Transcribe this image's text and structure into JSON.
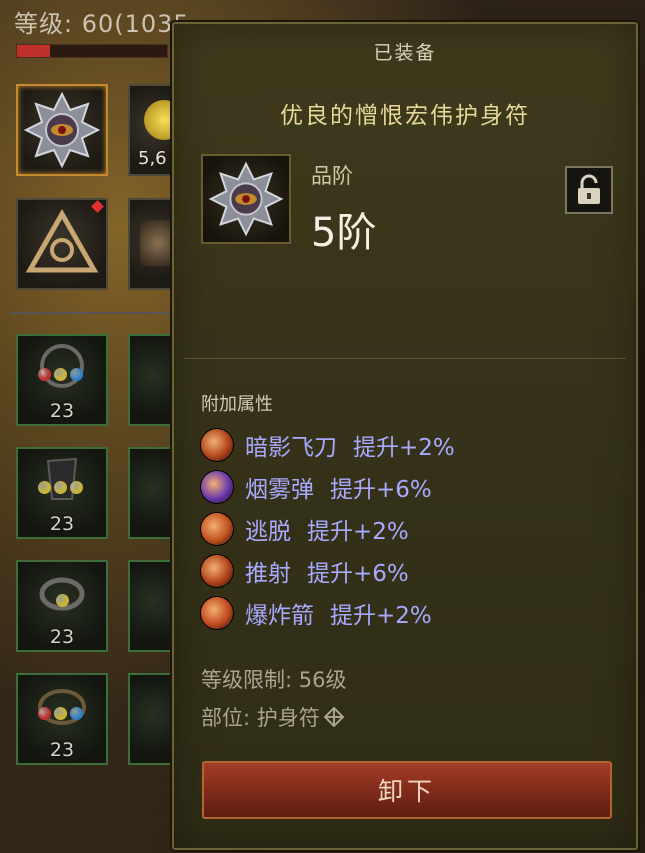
{
  "header": {
    "level_text": "等级: 60(1035"
  },
  "xp": {
    "progress": 0.22
  },
  "inventory": {
    "top_slot_partial_text": "5,6",
    "rows": [
      {
        "count": "23",
        "gems": [
          "#c33030",
          "#c9b43a",
          "#2f7fc8"
        ]
      },
      {
        "count": "23",
        "gems": [
          "#c9b43a",
          "#c9b43a",
          "#c9b43a"
        ]
      },
      {
        "count": "23",
        "gems": [
          "#c9b43a"
        ]
      },
      {
        "count": "23",
        "gems": [
          "#c33030",
          "#c9b43a",
          "#2f7fc8"
        ]
      }
    ]
  },
  "tooltip": {
    "equipped_label": "已装备",
    "item_name": "优良的憎恨宏伟护身符",
    "rank_label": "品阶",
    "rank_value": "5阶",
    "lock_icon": "padlock-open-icon",
    "bonus_title": "附加属性",
    "bonuses": [
      {
        "skill": "暗影飞刀",
        "effect": "提升+2%",
        "icon_color": "#b0441c"
      },
      {
        "skill": "烟雾弹",
        "effect": "提升+6%",
        "icon_color": "#6a3ab0"
      },
      {
        "skill": "逃脱",
        "effect": "提升+2%",
        "icon_color": "#c0501e"
      },
      {
        "skill": "推射",
        "effect": "提升+6%",
        "icon_color": "#b0441c"
      },
      {
        "skill": "爆炸箭",
        "effect": "提升+2%",
        "icon_color": "#c04a20"
      }
    ],
    "level_requirement": "等级限制: 56级",
    "slot_label": "部位: 护身符",
    "unequip_button": "卸下"
  },
  "colors": {
    "bonus_text": "#a9a9ff",
    "item_name": "#e6d89a",
    "button": "#8f3320"
  }
}
